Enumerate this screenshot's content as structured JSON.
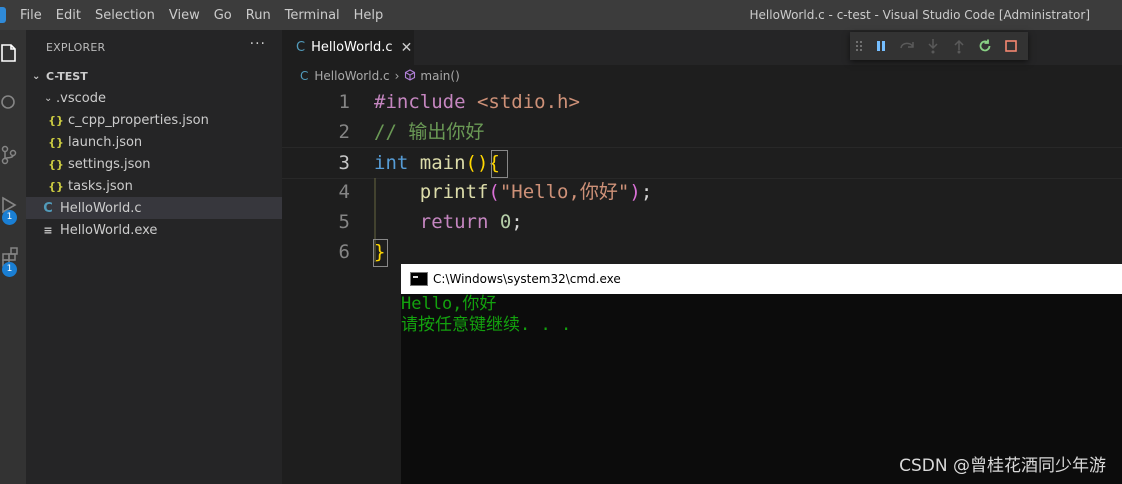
{
  "menu": [
    "File",
    "Edit",
    "Selection",
    "View",
    "Go",
    "Run",
    "Terminal",
    "Help"
  ],
  "window_title": "HelloWorld.c - c-test - Visual Studio Code [Administrator]",
  "activity": {
    "run_badge": "1",
    "ext_badge": "1"
  },
  "sidebar": {
    "header": "EXPLORER",
    "more": "···",
    "folder": "C-TEST",
    "items": [
      {
        "label": ".vscode",
        "kind": "folder"
      },
      {
        "label": "c_cpp_properties.json",
        "kind": "json",
        "icon": "{}"
      },
      {
        "label": "launch.json",
        "kind": "json",
        "icon": "{}"
      },
      {
        "label": "settings.json",
        "kind": "json",
        "icon": "{}"
      },
      {
        "label": "tasks.json",
        "kind": "json",
        "icon": "{}"
      },
      {
        "label": "HelloWorld.c",
        "kind": "c",
        "icon": "C"
      },
      {
        "label": "HelloWorld.exe",
        "kind": "exe",
        "icon": "≡"
      }
    ]
  },
  "tab": {
    "label": "HelloWorld.c",
    "icon": "C",
    "close": "✕"
  },
  "breadcrumb": {
    "file": "HelloWorld.c",
    "icon": "C",
    "sep": "›",
    "symbol": "main()"
  },
  "code": {
    "line_numbers": [
      "1",
      "2",
      "3",
      "4",
      "5",
      "6"
    ],
    "l1": {
      "kw": "#include",
      "inc": " <stdio.h>"
    },
    "l2": {
      "comment": "// 输出你好"
    },
    "l3": {
      "kw": "int",
      "fn": " main",
      "p1": "(",
      "p2": ")",
      "b1": "{"
    },
    "l4": {
      "indent": "    ",
      "fn": "printf",
      "p1": "(",
      "str": "\"Hello,你好\"",
      "p2": ")",
      "semi": ";"
    },
    "l5": {
      "indent": "    ",
      "kw": "return",
      "num": " 0",
      "semi": ";"
    },
    "l6": {
      "b1": "}"
    }
  },
  "cmd": {
    "title": "C:\\Windows\\system32\\cmd.exe",
    "output": [
      "Hello,你好",
      "请按任意键继续. . ."
    ]
  },
  "watermark": "CSDN @曾桂花酒同少年游"
}
